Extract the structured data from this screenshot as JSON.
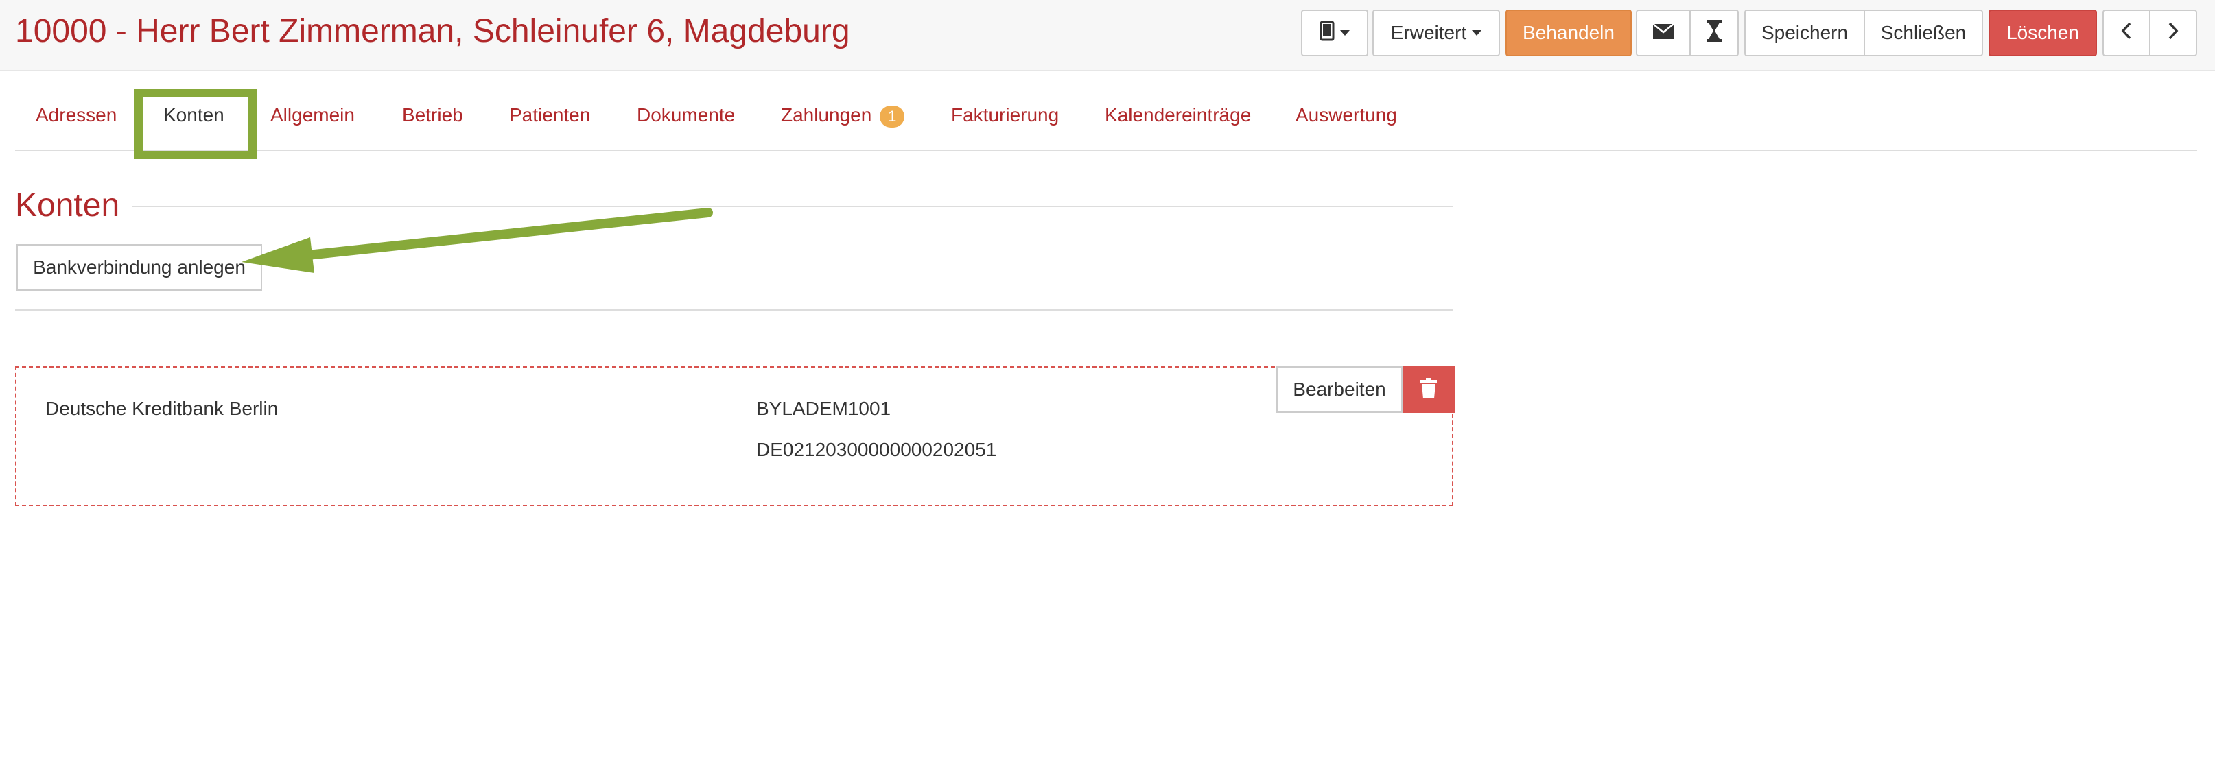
{
  "header": {
    "title": "10000 - Herr Bert Zimmerman, Schleinufer 6, Magdeburg"
  },
  "toolbar": {
    "device_icon": "tablet-icon",
    "erweitert_label": "Erweitert",
    "behandeln_label": "Behandeln",
    "mail_icon": "envelope-icon",
    "timer_icon": "hourglass-icon",
    "speichern_label": "Speichern",
    "schliessen_label": "Schließen",
    "loeschen_label": "Löschen",
    "prev_icon": "chevron-left-icon",
    "next_icon": "chevron-right-icon",
    "colors": {
      "accent": "#b0282a",
      "orange": "#e9914f",
      "danger": "#d9534f"
    }
  },
  "tabs": [
    {
      "label": "Adressen"
    },
    {
      "label": "Konten"
    },
    {
      "label": "Allgemein"
    },
    {
      "label": "Betrieb"
    },
    {
      "label": "Patienten"
    },
    {
      "label": "Dokumente"
    },
    {
      "label": "Zahlungen",
      "badge": "1"
    },
    {
      "label": "Fakturierung"
    },
    {
      "label": "Kalendereinträge"
    },
    {
      "label": "Auswertung"
    }
  ],
  "section": {
    "title": "Konten",
    "add_button_label": "Bankverbindung anlegen"
  },
  "account": {
    "bank_name": "Deutsche Kreditbank Berlin",
    "bic": "BYLADEM1001",
    "iban": "DE02120300000000202051",
    "edit_label": "Bearbeiten",
    "delete_icon": "trash-icon"
  },
  "annotation": {
    "highlight_color": "#87a93a"
  }
}
